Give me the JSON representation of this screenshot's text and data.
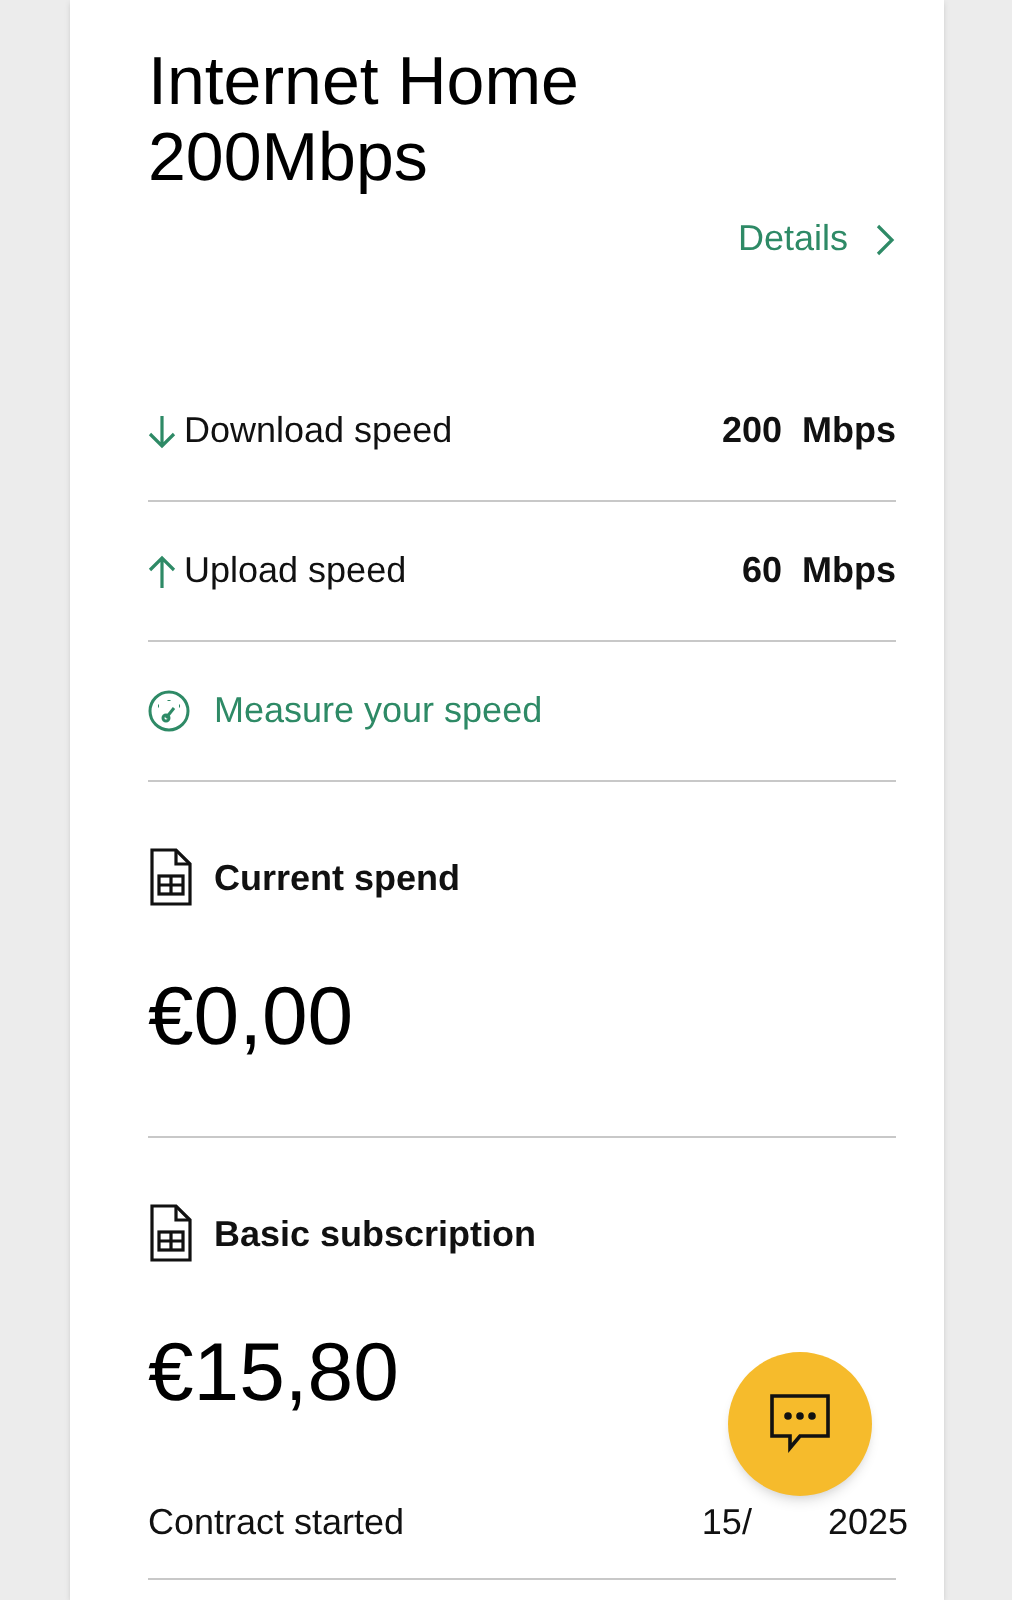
{
  "plan": {
    "title": "Internet Home 200Mbps",
    "details_link": "Details"
  },
  "speeds": [
    {
      "kind": "download",
      "label": "Download speed",
      "value": "200  Mbps"
    },
    {
      "kind": "upload",
      "label": "Upload speed",
      "value": "60  Mbps"
    }
  ],
  "measure_link": "Measure your speed",
  "costs": [
    {
      "label": "Current spend",
      "amount": "€0,00"
    },
    {
      "label": "Basic subscription",
      "amount": "€15,80"
    }
  ],
  "contract": {
    "label": "Contract started",
    "date_visible_start": "15/",
    "date_visible_end": "2025"
  }
}
